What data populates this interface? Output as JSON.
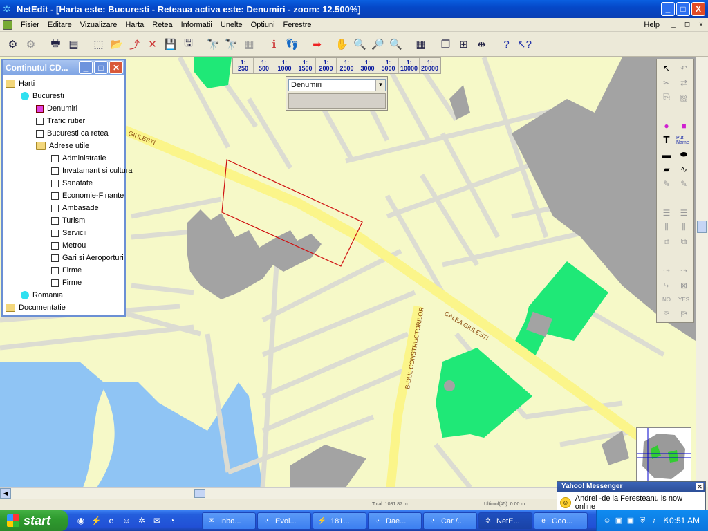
{
  "window": {
    "title": "NetEdit - [Harta este:  Bucuresti - Reteaua activa este:  Denumiri  - zoom: 12.500%]",
    "controls": [
      "_",
      "□",
      "X"
    ]
  },
  "menu": {
    "items": [
      "Fisier",
      "Editare",
      "Vizualizare",
      "Harta",
      "Retea",
      "Informatii",
      "Unelte",
      "Optiuni",
      "Ferestre"
    ],
    "help": "Help",
    "mdi_controls": [
      "_",
      "◻",
      "x"
    ]
  },
  "toolbar": {
    "buttons": [
      "open-layers",
      "layer-props",
      "print",
      "print-preview",
      "select-area",
      "open-folder",
      "route",
      "cut-route",
      "save",
      "save-all",
      "find",
      "find-address",
      "buildings",
      "info",
      "footprints",
      "export",
      "pan",
      "zoom",
      "zoom-in",
      "zoom-out",
      "grid",
      "cascade",
      "tile",
      "split",
      "help",
      "context-help"
    ]
  },
  "scale_buttons": [
    {
      "top": "1:",
      "val": "250"
    },
    {
      "top": "1:",
      "val": "500"
    },
    {
      "top": "1:",
      "val": "1000"
    },
    {
      "top": "1:",
      "val": "1500"
    },
    {
      "top": "1:",
      "val": "2000"
    },
    {
      "top": "1:",
      "val": "2500"
    },
    {
      "top": "1:",
      "val": "3000"
    },
    {
      "top": "1:",
      "val": "5000"
    },
    {
      "top": "1:",
      "val": "10000"
    },
    {
      "top": "1:",
      "val": "20000"
    }
  ],
  "layer_select": {
    "value": "Denumiri"
  },
  "left_panel": {
    "title": "Continutul CD...",
    "tree": {
      "harti": "Harti",
      "bucuresti": "Bucuresti",
      "denumiri": "Denumiri",
      "trafic": "Trafic rutier",
      "retea": "Bucuresti ca retea",
      "adrese": "Adrese utile",
      "administratie": "Administratie",
      "invatamant": "Invatamant si cultura",
      "sanatate": "Sanatate",
      "economie": "Economie-Finante",
      "ambasade": "Ambasade",
      "turism": "Turism",
      "servicii": "Servicii",
      "metrou": "Metrou",
      "gari": "Gari si Aeroporturi",
      "firme1": "Firme",
      "firme2": "Firme",
      "romania": "Romania",
      "documentatie": "Documentatie"
    }
  },
  "map_labels": {
    "giulesti_left": "GIULESTI",
    "calea_giulesti": "CALEA GIULESTI",
    "constructorilor": "B-DUL CONSTRUCTORILOR"
  },
  "palette": {
    "text_tool": "T",
    "name_tool": "Put Name",
    "no": "NO",
    "yes": "YES"
  },
  "statusbar": {
    "total": "Total:  1081.87 m",
    "ultimul": "Ultimul(#5):   0.00 m"
  },
  "toast": {
    "title": "Yahoo! Messenger",
    "message": "Andrei -de la Feresteanu is now online"
  },
  "taskbar": {
    "start": "start",
    "tasks": [
      "Inbo...",
      "Evol...",
      "181...",
      "Dae...",
      "Car /...",
      "NetE...",
      "Goo..."
    ],
    "clock": "10:51 AM"
  },
  "colors": {
    "map_bg": "#f6f9c8",
    "road": "#dcdcd2",
    "main_road": "#fbf58a",
    "building": "#a3a3a3",
    "park": "#1fe877",
    "water": "#8fc4f4",
    "selection": "#d01010"
  }
}
